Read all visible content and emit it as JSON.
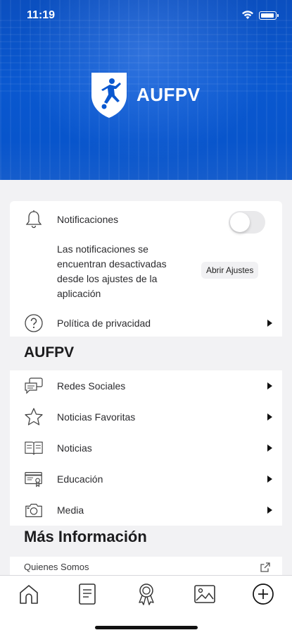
{
  "status_bar": {
    "time": "11:19"
  },
  "header": {
    "brand_name": "AUFPV"
  },
  "settings": {
    "notifications_label": "Notificaciones",
    "notifications_enabled": false,
    "notice_text": "Las notificaciones se encuentran desactivadas desde los ajustes de la aplicación",
    "open_settings_label": "Abrir Ajustes",
    "privacy_label": "Política de privacidad"
  },
  "sections": {
    "aufpv_title": "AUFPV",
    "more_info_title": "Más Información"
  },
  "menu": {
    "items": [
      {
        "label": "Redes Sociales",
        "icon": "chat-bubbles-icon"
      },
      {
        "label": "Noticias Favoritas",
        "icon": "star-icon"
      },
      {
        "label": "Noticias",
        "icon": "book-icon"
      },
      {
        "label": "Educación",
        "icon": "certificate-icon"
      },
      {
        "label": "Media",
        "icon": "camera-icon"
      }
    ]
  },
  "more_info": {
    "about_label": "Quienes Somos",
    "icon": "external-link-icon"
  },
  "tab_bar": {
    "tabs": [
      {
        "icon": "home-icon"
      },
      {
        "icon": "document-icon"
      },
      {
        "icon": "award-icon"
      },
      {
        "icon": "gallery-icon"
      },
      {
        "icon": "add-circle-icon"
      }
    ]
  },
  "colors": {
    "header_blue": "#0a58d0",
    "background": "#f2f2f4",
    "card": "#ffffff",
    "toggle_off": "#e9e9eb"
  }
}
